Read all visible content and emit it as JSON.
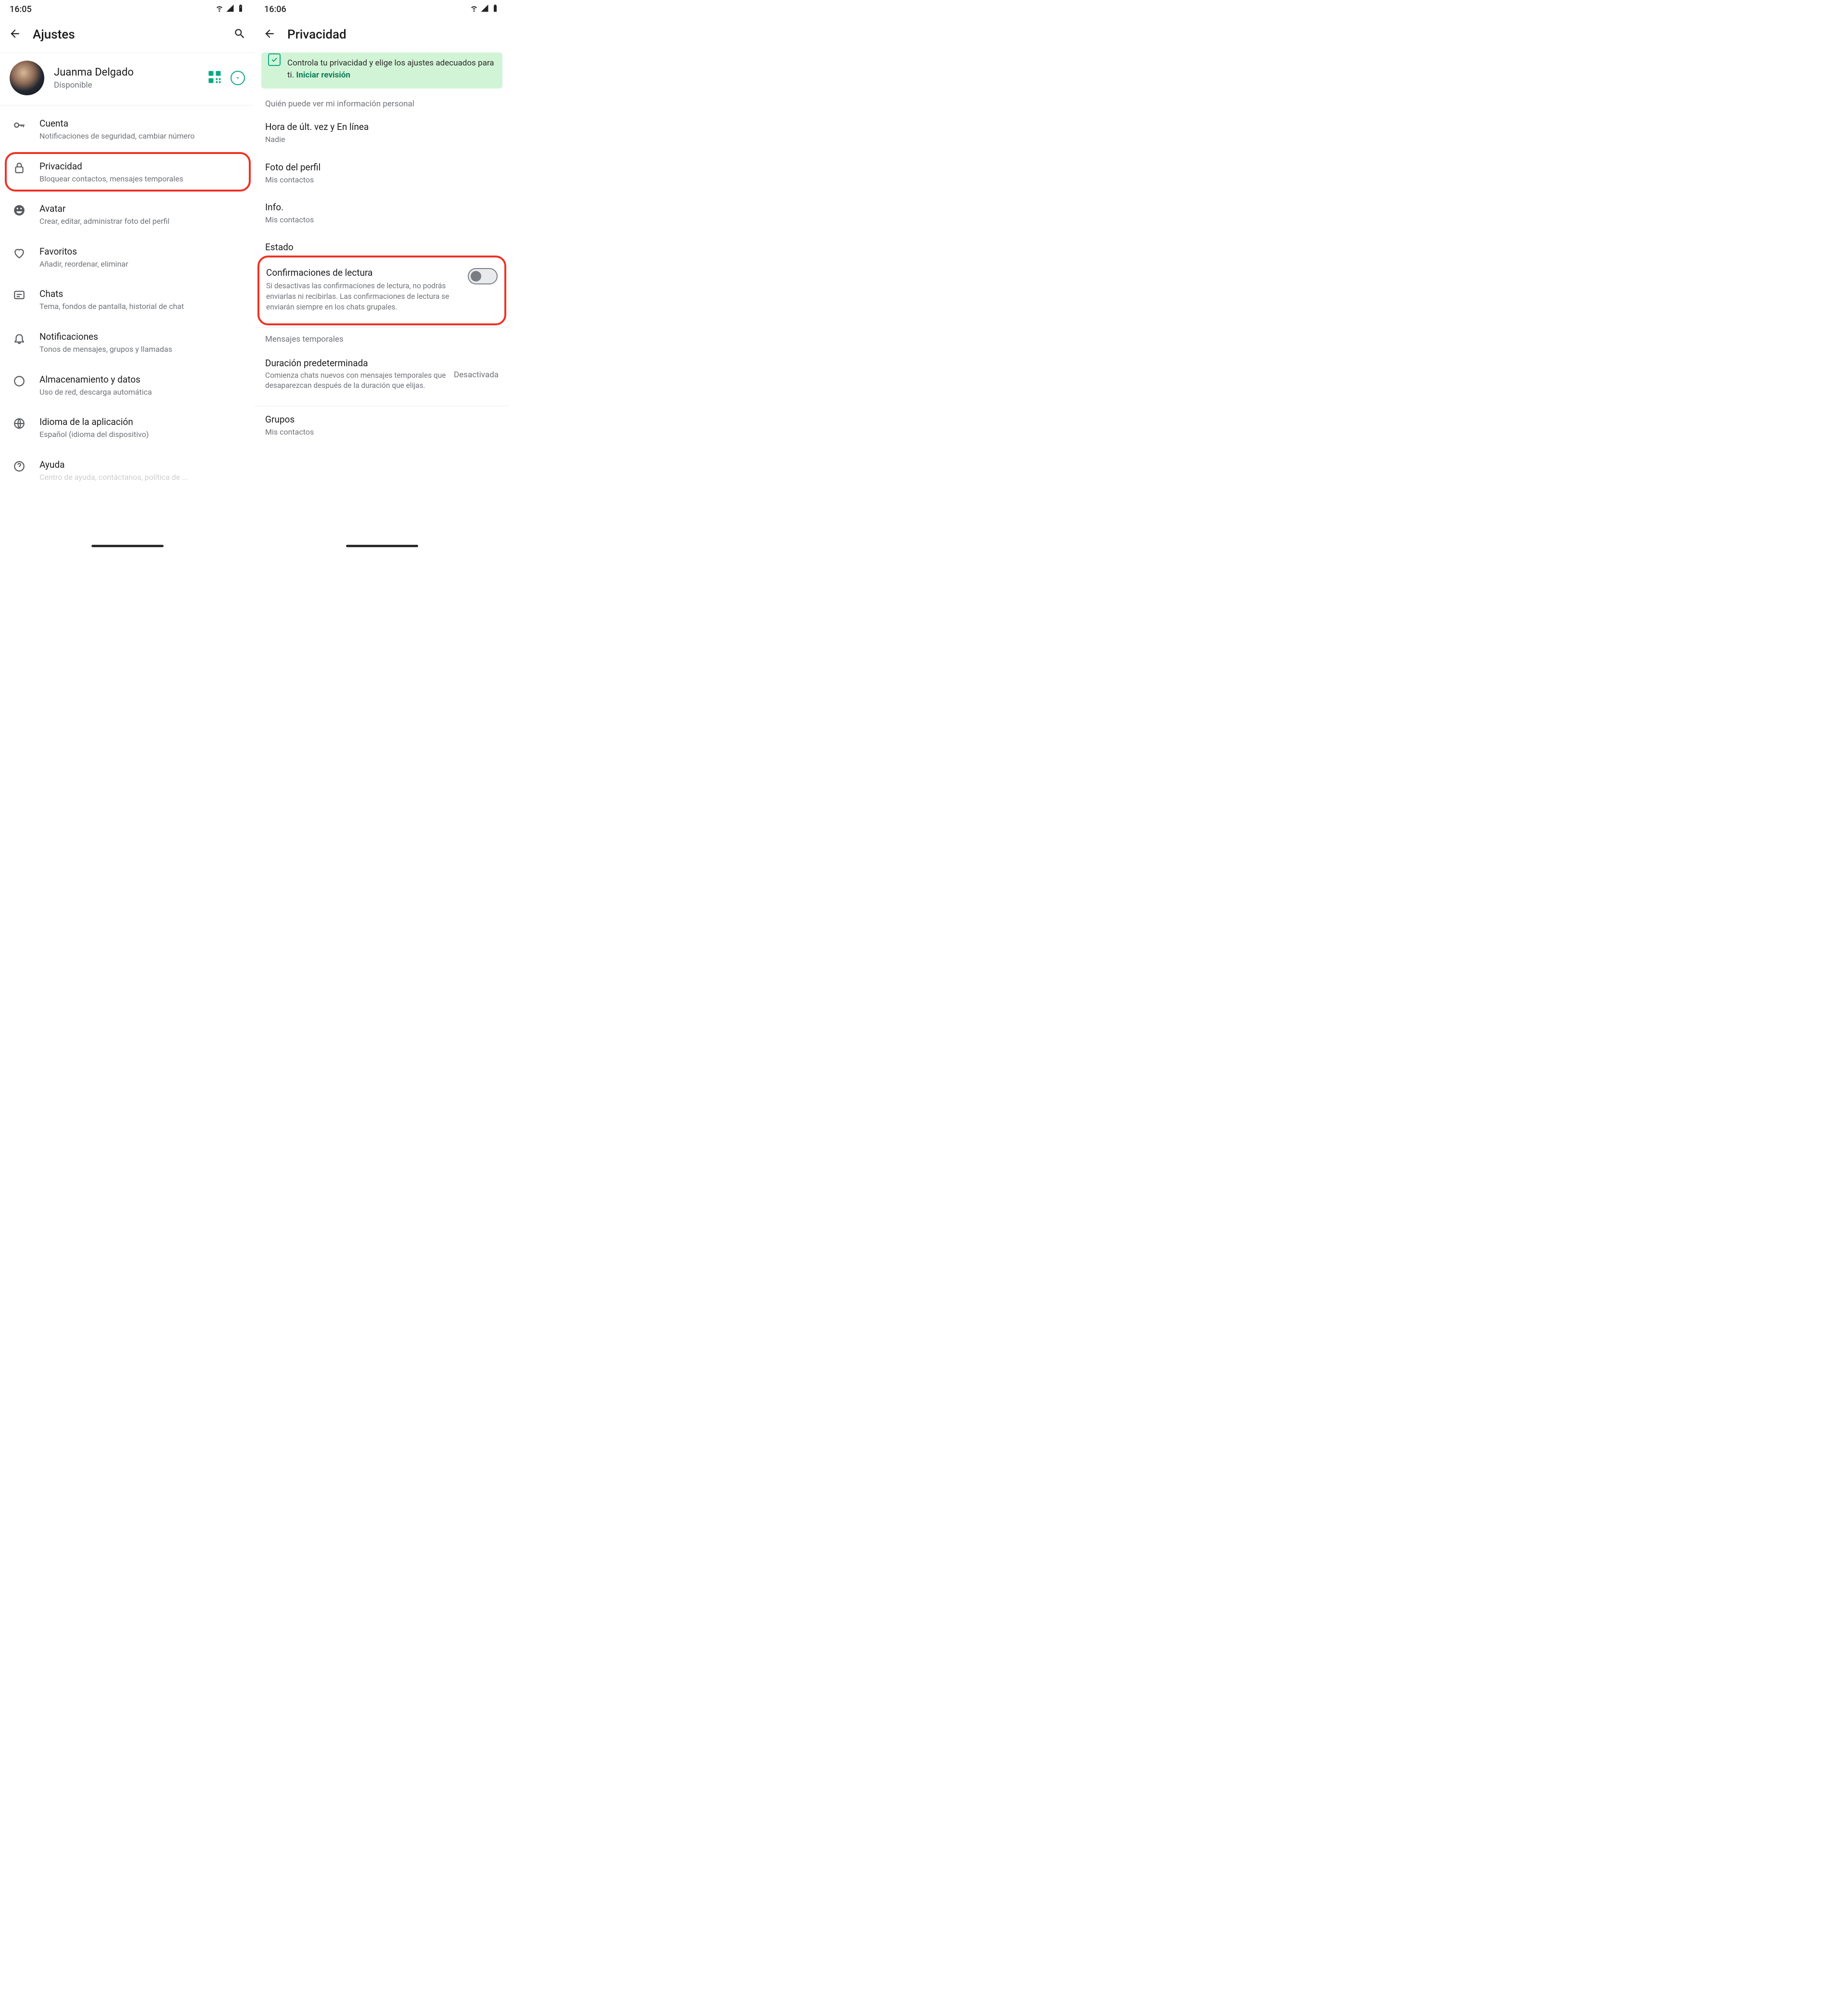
{
  "left": {
    "status_time": "16:05",
    "appbar_title": "Ajustes",
    "profile_name": "Juanma Delgado",
    "profile_status": "Disponible",
    "items": [
      {
        "title": "Cuenta",
        "subtitle": "Notificaciones de seguridad, cambiar número"
      },
      {
        "title": "Privacidad",
        "subtitle": "Bloquear contactos, mensajes temporales"
      },
      {
        "title": "Avatar",
        "subtitle": "Crear, editar, administrar foto del perfil"
      },
      {
        "title": "Favoritos",
        "subtitle": "Añadir, reordenar, eliminar"
      },
      {
        "title": "Chats",
        "subtitle": "Tema, fondos de pantalla, historial de chat"
      },
      {
        "title": "Notificaciones",
        "subtitle": "Tonos de mensajes, grupos y llamadas"
      },
      {
        "title": "Almacenamiento y datos",
        "subtitle": "Uso de red, descarga automática"
      },
      {
        "title": "Idioma de la aplicación",
        "subtitle": "Español (idioma del dispositivo)"
      },
      {
        "title": "Ayuda",
        "subtitle": "Centro de ayuda, contáctanos, política de ..."
      }
    ]
  },
  "right": {
    "status_time": "16:06",
    "appbar_title": "Privacidad",
    "banner_text": "Controla tu privacidad y elige los ajustes adecuados para ti. ",
    "banner_link": "Iniciar revisión",
    "section_personal": "Quién puede ver mi información personal",
    "items": [
      {
        "title": "Hora de últ. vez y En línea",
        "value": "Nadie"
      },
      {
        "title": "Foto del perfil",
        "value": "Mis contactos"
      },
      {
        "title": "Info.",
        "value": "Mis contactos"
      },
      {
        "title": "Estado",
        "value": ""
      }
    ],
    "read_receipts_title": "Confirmaciones de lectura",
    "read_receipts_desc": "Si desactivas las confirmaciones de lectura, no podrás enviarlas ni recibirlas. Las confirmaciones de lectura se enviarán siempre en los chats grupales.",
    "section_temp": "Mensajes temporales",
    "duration_title": "Duración predeterminada",
    "duration_desc": "Comienza chats nuevos con mensajes temporales que desaparezcan después de la duración que elijas.",
    "duration_state": "Desactivada",
    "groups_title": "Grupos",
    "groups_value": "Mis contactos"
  }
}
